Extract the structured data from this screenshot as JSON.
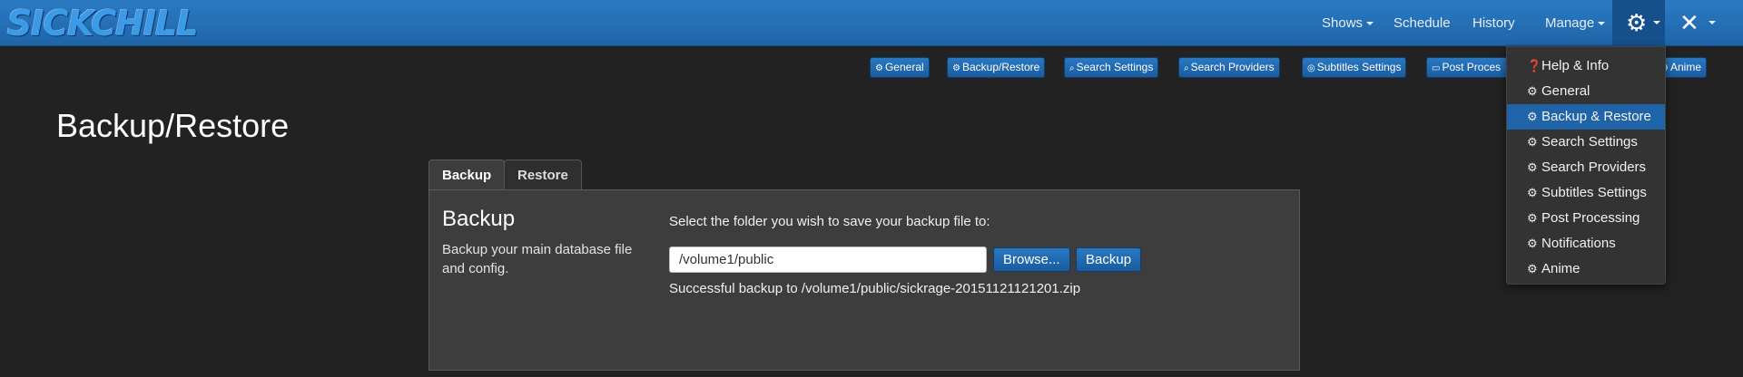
{
  "app": {
    "logo": "SICKCHILL"
  },
  "nav": {
    "shows": "Shows",
    "schedule": "Schedule",
    "history": "History",
    "manage": "Manage",
    "config_icon": "gear-icon",
    "tools_icon": "tools-icon"
  },
  "submenu": {
    "general": "General",
    "backup_restore": "Backup/Restore",
    "search_settings": "Search Settings",
    "search_providers": "Search Providers",
    "subtitles_settings": "Subtitles Settings",
    "post_processing": "Post Proces",
    "anime": "Anime"
  },
  "page": {
    "title": "Backup/Restore"
  },
  "tabs": {
    "backup": "Backup",
    "restore": "Restore"
  },
  "backup_panel": {
    "heading": "Backup",
    "description": "Backup your main database file and config.",
    "select_label": "Select the folder you wish to save your backup file to:",
    "path_value": "/volume1/public",
    "browse_label": "Browse...",
    "backup_label": "Backup",
    "status": "Successful backup to /volume1/public/sickrage-20151121121201.zip"
  },
  "config_menu": {
    "items": [
      {
        "label": "Help & Info",
        "icon": "question-circle-icon"
      },
      {
        "label": "General",
        "icon": "gear-icon"
      },
      {
        "label": "Backup & Restore",
        "icon": "gear-icon"
      },
      {
        "label": "Search Settings",
        "icon": "gear-icon"
      },
      {
        "label": "Search Providers",
        "icon": "gear-icon"
      },
      {
        "label": "Subtitles Settings",
        "icon": "gear-icon"
      },
      {
        "label": "Post Processing",
        "icon": "gear-icon"
      },
      {
        "label": "Notifications",
        "icon": "gear-icon"
      },
      {
        "label": "Anime",
        "icon": "gear-icon"
      }
    ],
    "active": "Backup & Restore"
  },
  "colors": {
    "navbar": "#1f64a8",
    "background": "#222222",
    "panel": "#3d3d3d",
    "button": "#1f64a8",
    "dropdown_active": "#1f64a8"
  }
}
